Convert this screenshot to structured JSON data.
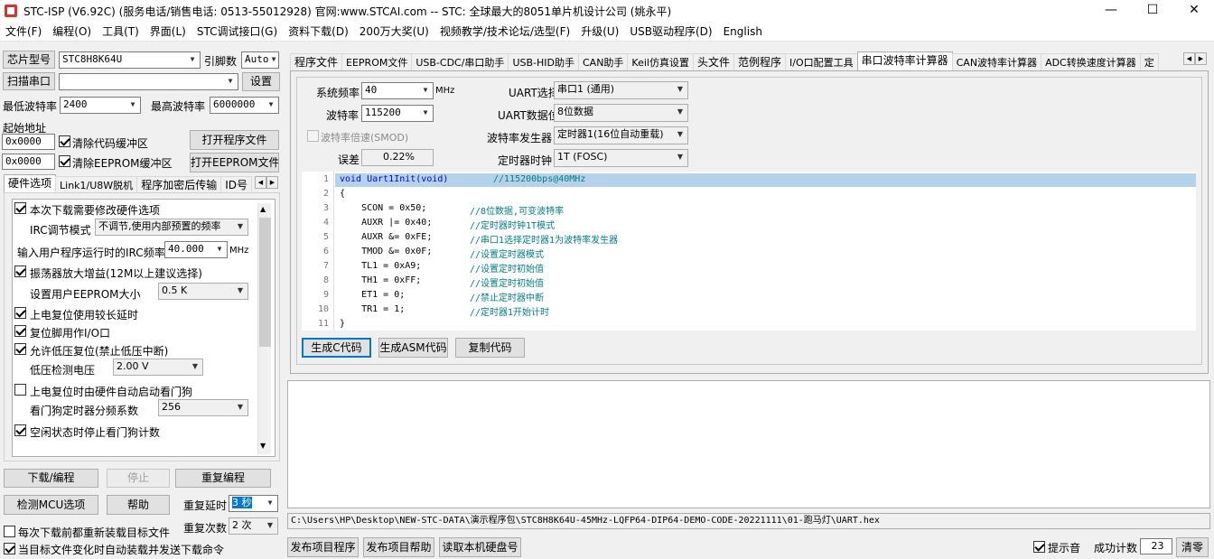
{
  "window": {
    "title": "STC-ISP (V6.92C) (服务电话/销售电话: 0513-55012928) 官网:www.STCAI.com  -- STC: 全球最大的8051单片机设计公司 (姚永平)",
    "min": "—",
    "max": "☐",
    "close": "✕"
  },
  "menu": [
    "文件(F)",
    "编程(O)",
    "工具(T)",
    "界面(L)",
    "STC调试接口(G)",
    "资料下载(D)",
    "200万大奖(U)",
    "视频教学/技术论坛/选型(F)",
    "升级(U)",
    "USB驱动程序(D)",
    "English"
  ],
  "left": {
    "chip_label": "芯片型号",
    "chip_value": "STC8H8K64U",
    "pin_label": "引脚数",
    "pin_value": "Auto",
    "scan_label": "扫描串口",
    "port_value": "",
    "settings_label": "设置",
    "min_baud_label": "最低波特率",
    "min_baud": "2400",
    "max_baud_label": "最高波特率",
    "max_baud": "6000000",
    "start_addr_label": "起始地址",
    "addr1": "0x0000",
    "addr2": "0x0000",
    "clear_code_label": "清除代码缓冲区",
    "clear_eeprom_label": "清除EEPROM缓冲区",
    "open_prog_label": "打开程序文件",
    "open_eeprom_label": "打开EEPROM文件",
    "tabs": [
      "硬件选项",
      "Link1/U8W脱机",
      "程序加密后传输",
      "ID号"
    ],
    "options": {
      "opt1": "本次下载需要修改硬件选项",
      "irc_label": "IRC调节模式",
      "irc_value": "不调节,使用内部预置的频率",
      "freq_label": "输入用户程序运行时的IRC频率",
      "freq_value": "40.000",
      "freq_unit": "MHz",
      "opt_osc": "振荡器放大增益(12M以上建议选择)",
      "eeprom_size_label": "设置用户EEPROM大小",
      "eeprom_size": "0.5 K",
      "opt_reset_delay": "上电复位使用较长延时",
      "opt_reset_io": "复位脚用作I/O口",
      "opt_lvd": "允许低压复位(禁止低压中断)",
      "lvd_label": "低压检测电压",
      "lvd_value": "2.00 V",
      "opt_wdt": "上电复位时由硬件自动启动看门狗",
      "wdt_label": "看门狗定时器分频系数",
      "wdt_value": "256",
      "opt_idle": "空闲状态时停止看门狗计数"
    },
    "download_label": "下载/编程",
    "stop_label": "停止",
    "reprogram_label": "重复编程",
    "detect_label": "检测MCU选项",
    "help_label": "帮助",
    "repeat_delay_label": "重复延时",
    "repeat_delay": "3 秒",
    "repeat_count_label": "重复次数",
    "repeat_count": "2 次",
    "reload_label": "每次下载前都重新装载目标文件",
    "auto_label": "当目标文件变化时自动装载并发送下载命令"
  },
  "right": {
    "tabs": [
      "程序文件",
      "EEPROM文件",
      "USB-CDC/串口助手",
      "USB-HID助手",
      "CAN助手",
      "Keil仿真设置",
      "头文件",
      "范例程序",
      "I/O口配置工具",
      "串口波特率计算器",
      "CAN波特率计算器",
      "ADC转换速度计算器",
      "定"
    ],
    "sysclk_label": "系统频率",
    "sysclk": "40",
    "sysclk_unit": "MHz",
    "baud_label": "波特率",
    "baud": "115200",
    "smod_label": "波特率倍速(SMOD)",
    "error_label": "误差",
    "error": "0.22%",
    "uart_label": "UART选择",
    "uart": "串口1 (通用)",
    "bits_label": "UART数据位",
    "bits": "8位数据",
    "gen_label": "波特率发生器",
    "gen": "定时器1(16位自动重载)",
    "tclk_label": "定时器时钟",
    "tclk": "1T  (FOSC)",
    "gen_c_label": "生成C代码",
    "gen_asm_label": "生成ASM代码",
    "copy_label": "复制代码",
    "code": [
      {
        "n": "1",
        "c": "void Uart1Init(void)",
        "m": "//115200bps@40MHz"
      },
      {
        "n": "2",
        "c": "{",
        "m": ""
      },
      {
        "n": "3",
        "c": "    SCON = 0x50;",
        "m": "//8位数据,可变波特率"
      },
      {
        "n": "4",
        "c": "    AUXR |= 0x40;",
        "m": "//定时器时钟1T模式"
      },
      {
        "n": "5",
        "c": "    AUXR &= 0xFE;",
        "m": "//串口1选择定时器1为波特率发生器"
      },
      {
        "n": "6",
        "c": "    TMOD &= 0x0F;",
        "m": "//设置定时器模式"
      },
      {
        "n": "7",
        "c": "    TL1 = 0xA9;",
        "m": "//设置定时初始值"
      },
      {
        "n": "8",
        "c": "    TH1 = 0xFF;",
        "m": "//设置定时初始值"
      },
      {
        "n": "9",
        "c": "    ET1 = 0;",
        "m": "//禁止定时器中断"
      },
      {
        "n": "10",
        "c": "    TR1 = 1;",
        "m": "//定时器1开始计时"
      },
      {
        "n": "11",
        "c": "}",
        "m": ""
      }
    ],
    "path": "C:\\Users\\HP\\Desktop\\NEW-STC-DATA\\演示程序包\\STC8H8K64U-45MHz-LQFP64-DIP64-DEMO-CODE-20221111\\01-跑马灯\\UART.hex",
    "publish_label": "发布项目程序",
    "publish_help_label": "发布项目帮助",
    "read_disk_label": "读取本机硬盘号",
    "beep_label": "提示音",
    "success_label": "成功计数",
    "success_count": "23",
    "clear_label": "清零"
  }
}
